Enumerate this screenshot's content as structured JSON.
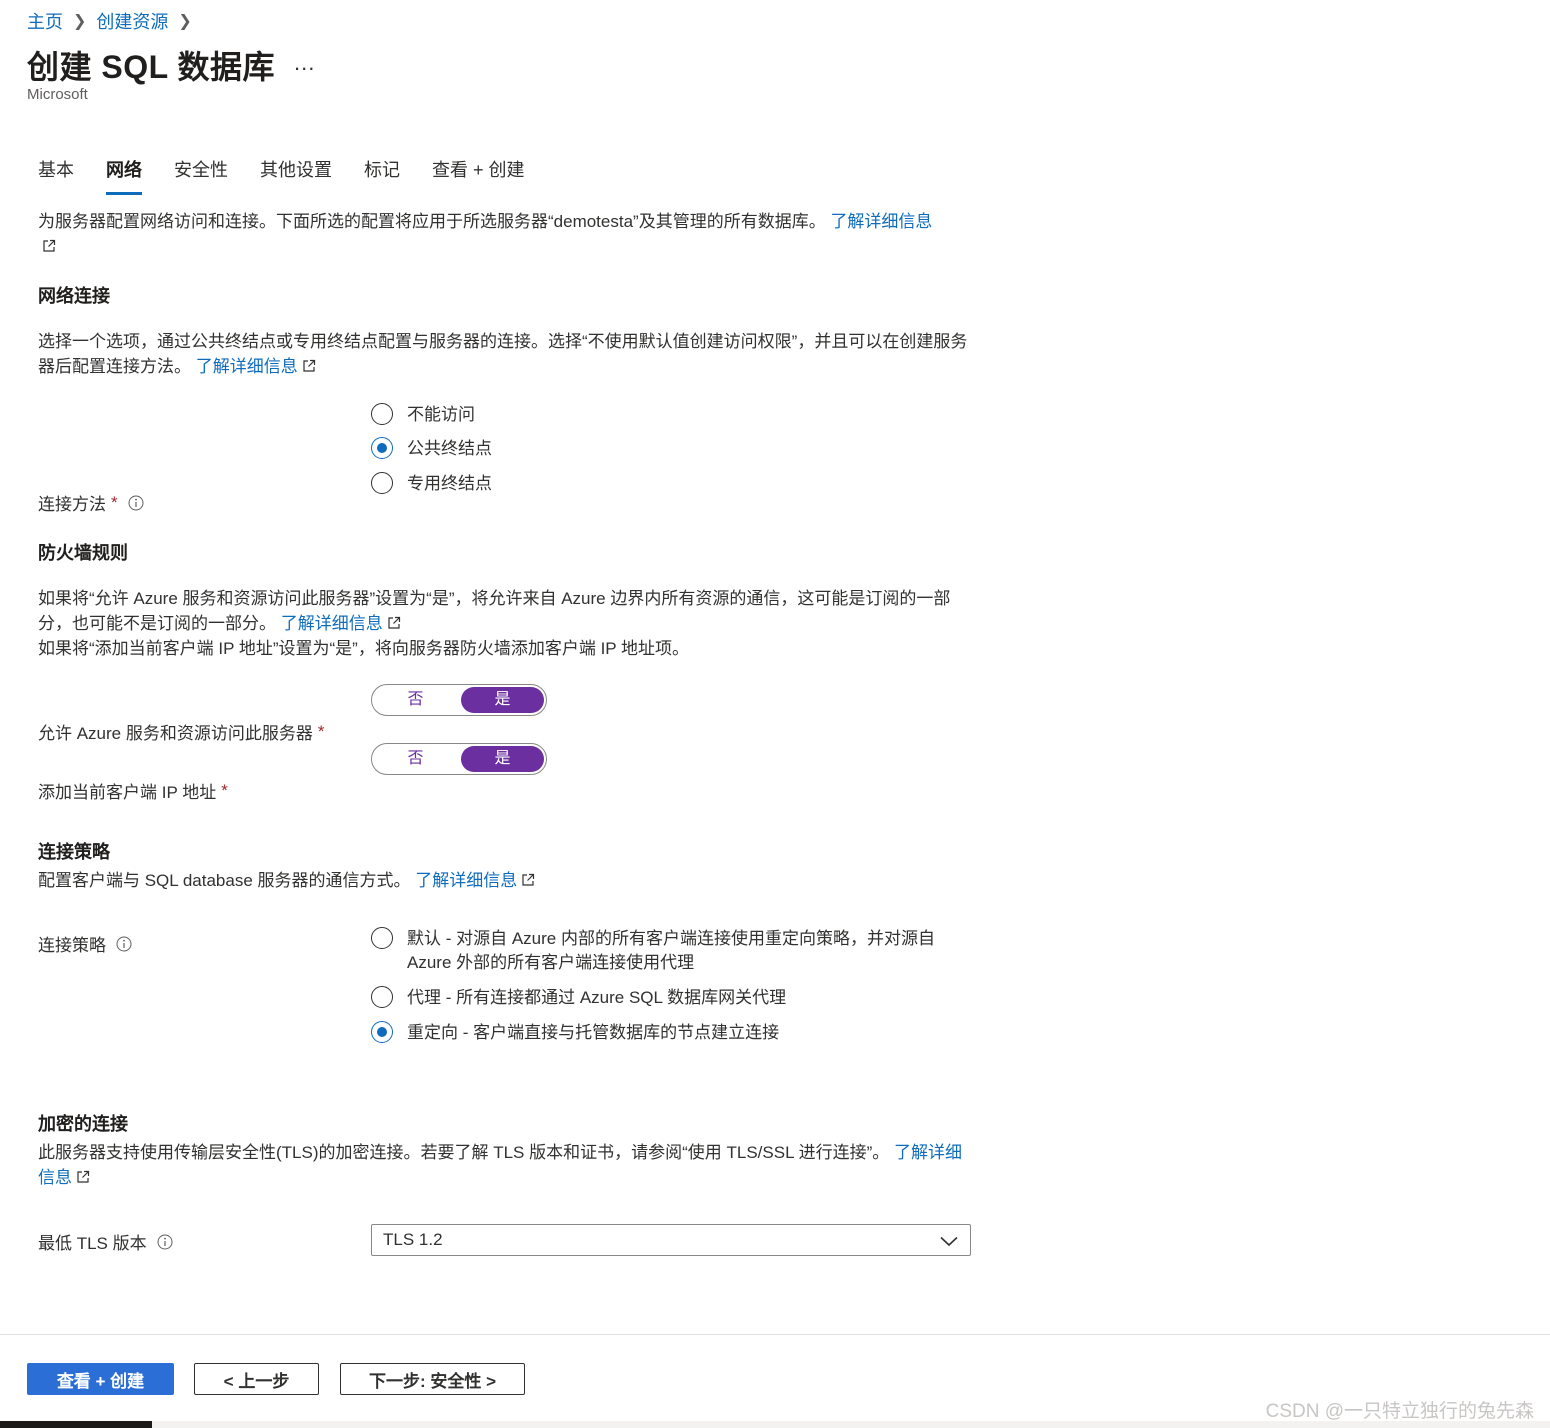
{
  "breadcrumb": {
    "home": "主页",
    "create_resource": "创建资源"
  },
  "header": {
    "title": "创建 SQL 数据库",
    "more": "...",
    "publisher": "Microsoft"
  },
  "tabs": [
    {
      "label": "基本",
      "active": false
    },
    {
      "label": "网络",
      "active": true
    },
    {
      "label": "安全性",
      "active": false
    },
    {
      "label": "其他设置",
      "active": false
    },
    {
      "label": "标记",
      "active": false
    },
    {
      "label": "查看 + 创建",
      "active": false
    }
  ],
  "intro": {
    "text": "为服务器配置网络访问和连接。下面所选的配置将应用于所选服务器“demotesta”及其管理的所有数据库。",
    "link": "了解详细信息"
  },
  "network": {
    "title": "网络连接",
    "desc": "选择一个选项，通过公共终结点或专用终结点配置与服务器的连接。选择“不使用默认值创建访问权限”，并且可以在创建服务器后配置连接方法。",
    "link": "了解详细信息",
    "label": "连接方法",
    "required": "*",
    "options": [
      {
        "label": "不能访问",
        "checked": false
      },
      {
        "label": "公共终结点",
        "checked": true
      },
      {
        "label": "专用终结点",
        "checked": false
      }
    ]
  },
  "firewall": {
    "title": "防火墙规则",
    "desc1": "如果将“允许 Azure 服务和资源访问此服务器”设置为“是”，将允许来自 Azure 边界内所有资源的通信，这可能是订阅的一部分，也可能不是订阅的一部分。",
    "link": "了解详细信息",
    "desc2": "如果将“添加当前客户端 IP 地址”设置为“是”，将向服务器防火墙添加客户端 IP 地址项。",
    "allow_azure_label": "允许 Azure 服务和资源访问此服务器",
    "add_ip_label": "添加当前客户端 IP 地址",
    "required": "*",
    "no": "否",
    "yes": "是"
  },
  "policy": {
    "title": "连接策略",
    "desc": "配置客户端与 SQL database 服务器的通信方式。",
    "link": "了解详细信息",
    "label": "连接策略",
    "options": [
      {
        "line1": "默认 - 对源自 Azure 内部的所有客户端连接使用重定向策略，并对源自",
        "line2": "Azure 外部的所有客户端连接使用代理",
        "checked": false
      },
      {
        "line1": "代理 - 所有连接都通过 Azure SQL 数据库网关代理",
        "checked": false
      },
      {
        "line1": "重定向 - 客户端直接与托管数据库的节点建立连接",
        "checked": true
      }
    ]
  },
  "encryption": {
    "title": "加密的连接",
    "desc": "此服务器支持使用传输层安全性(TLS)的加密连接。若要了解 TLS 版本和证书，请参阅“使用 TLS/SSL 进行连接”。",
    "link_part1": "了解详细",
    "link_part2": "信息",
    "tls_label": "最低 TLS 版本",
    "tls_value": "TLS 1.2"
  },
  "footer": {
    "review_create": "查看 + 创建",
    "previous": "< 上一步",
    "next": "下一步: 安全性 >"
  },
  "watermark": "CSDN @一只特立独行的兔先森",
  "colors": {
    "accent": "#0f6cbd",
    "toggle": "#6b2fa0",
    "primary_button": "#2b6fd6",
    "required": "#a4262c"
  }
}
